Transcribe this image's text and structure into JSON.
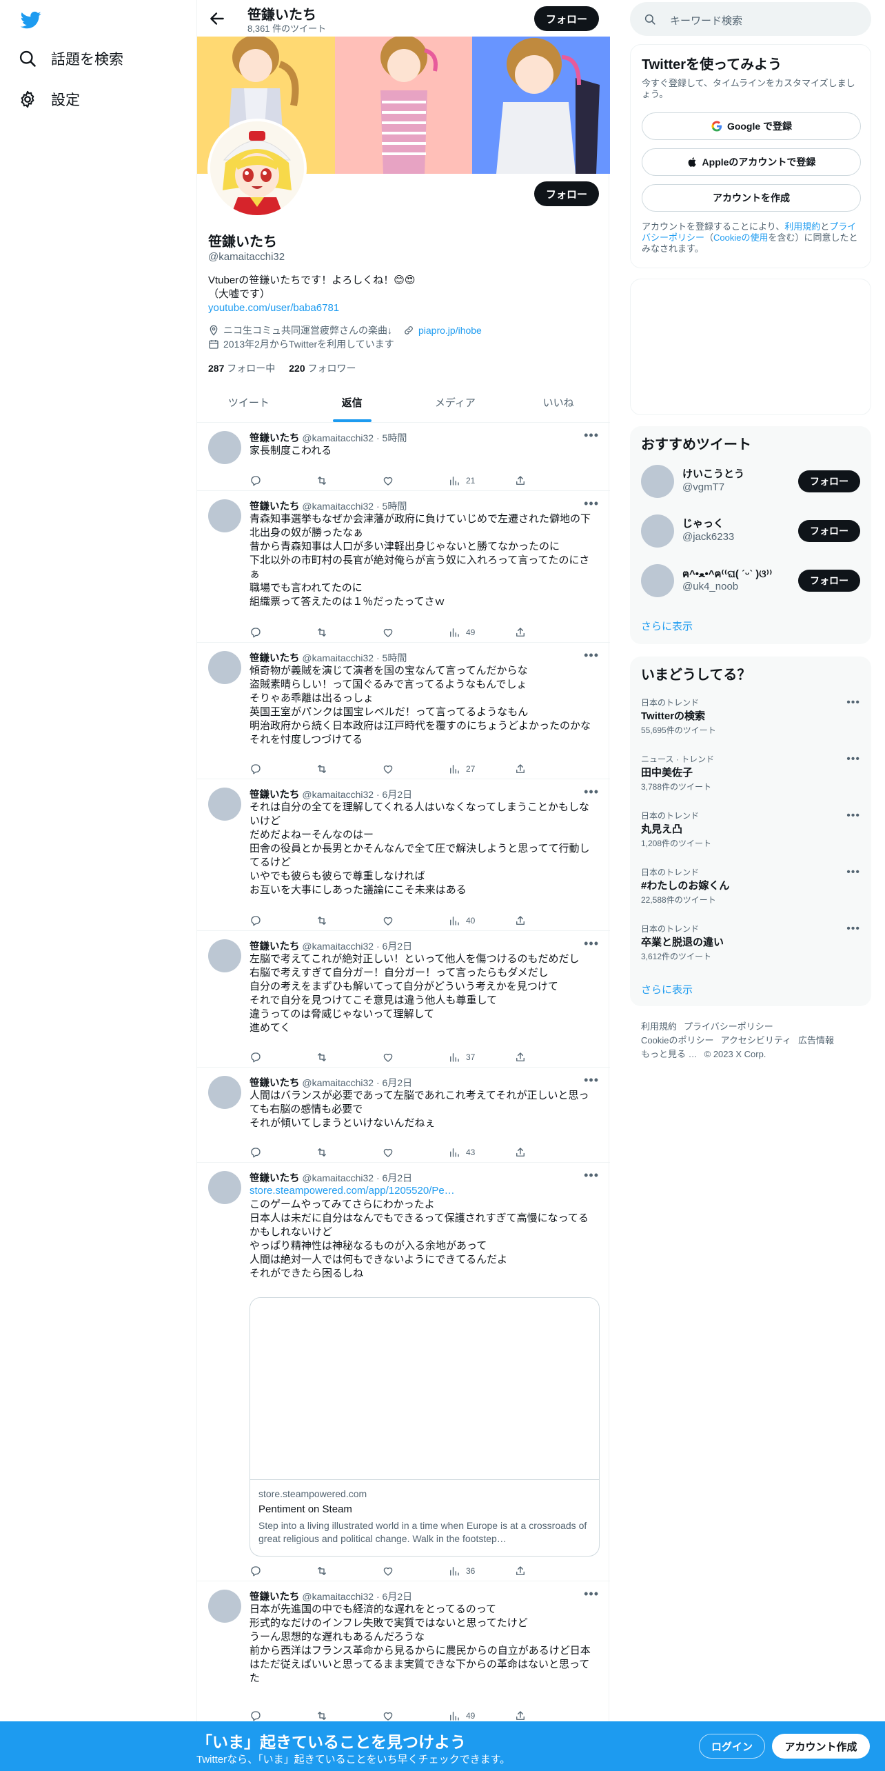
{
  "nav": {
    "items": [
      {
        "label": "話題を検索",
        "icon": "search-icon"
      },
      {
        "label": "設定",
        "icon": "gear-icon"
      }
    ]
  },
  "header": {
    "name": "笹鎌いたち",
    "tweet_count": "8,361 件のツイート",
    "follow_label": "フォロー"
  },
  "profile": {
    "name": "笹鎌いたち",
    "handle": "@kamaitacchi32",
    "follow_label": "フォロー",
    "bio_lines": [
      "Vtuberの笹鎌いたちです！よろしくね！😊😍",
      "（大嘘です）"
    ],
    "bio_link": "youtube.com/user/baba6781",
    "location": "ニコ生コミュ共同運営疲弊さんの楽曲↓",
    "website": "piapro.jp/ihobe",
    "joined": "2013年2月からTwitterを利用しています",
    "following_count": "287",
    "following_label": "フォロー中",
    "followers_count": "220",
    "followers_label": "フォロワー"
  },
  "tabs": [
    {
      "label": "ツイート"
    },
    {
      "label": "返信",
      "active": true
    },
    {
      "label": "メディア"
    },
    {
      "label": "いいね"
    }
  ],
  "tweets": [
    {
      "name": "笹鎌いたち",
      "meta": "@kamaitacchi32 · 5時間",
      "lines": [
        "家長制度こわれる"
      ],
      "views": "21"
    },
    {
      "name": "笹鎌いたち",
      "meta": "@kamaitacchi32 · 5時間",
      "lines": [
        "青森知事選挙もなぜか会津藩が政府に負けていじめで左遷された僻地の下",
        "北出身の奴が勝ったなぁ",
        "昔から青森知事は人口が多い津軽出身じゃないと勝てなかったのに",
        "下北以外の市町村の長官が絶対俺らが言う奴に入れろって言ってたのにさ",
        "ぁ",
        "職場でも言われてたのに",
        "組織票って答えたのは１％だったってさｗ"
      ],
      "views": "49"
    },
    {
      "name": "笹鎌いたち",
      "meta": "@kamaitacchi32 · 5時間",
      "lines": [
        "傾奇物が義賊を演じて演者を国の宝なんて言ってんだからな",
        "盗賊素晴らしい！って国ぐるみで言ってるようなもんでしょ",
        "そりゃあ乖離は出るっしょ",
        "英国王室がパンクは国宝レベルだ！って言ってるようなもん",
        "明治政府から続く日本政府は江戸時代を覆すのにちょうどよかったのかな",
        "それを忖度しつづけてる"
      ],
      "views": "27"
    },
    {
      "name": "笹鎌いたち",
      "meta": "@kamaitacchi32 · 6月2日",
      "lines": [
        "それは自分の全てを理解してくれる人はいなくなってしまうことかもしな",
        "いけど",
        "だめだよねーそんなのはー",
        "田舎の役員とか長男とかそんなんで全て圧で解決しようと思ってて行動し",
        "てるけど",
        "いやでも彼らも彼らで尊重しなければ",
        "お互いを大事にしあった議論にこそ未来はある"
      ],
      "views": "40"
    },
    {
      "name": "笹鎌いたち",
      "meta": "@kamaitacchi32 · 6月2日",
      "lines": [
        "左脳で考えてこれが絶対正しい！といって他人を傷つけるのもだめだし",
        "右脳で考えすぎて自分ガー！自分ガー！って言ったらもダメだし",
        "自分の考えをまずひも解いてって自分がどういう考えかを見つけて",
        "それで自分を見つけてこそ意見は違う他人も尊重して",
        "違うってのは脅威じゃないって理解して",
        "進めてく"
      ],
      "views": "37"
    },
    {
      "name": "笹鎌いたち",
      "meta": "@kamaitacchi32 · 6月2日",
      "lines": [
        "人間はバランスが必要であって左脳であれこれ考えてそれが正しいと思っ",
        "ても右脳の感情も必要で",
        "それが傾いてしまうといけないんだねぇ"
      ],
      "views": "43"
    },
    {
      "name": "笹鎌いたち",
      "meta": "@kamaitacchi32 · 6月2日",
      "link": "store.steampowered.com/app/1205520/Pe…",
      "lines": [
        "このゲームやってみてさらにわかったよ",
        "日本人は未だに自分はなんでもできるって保護されすぎて高慢になってる",
        "かもしれないけど",
        "やっぱり精神性は神秘なるものが入る余地があって",
        "人間は絶対一人では何もできないようにできてるんだよ",
        "それができたら困るしね"
      ],
      "card": {
        "domain": "store.steampowered.com",
        "title": "Pentiment on Steam",
        "desc": "Step into a living illustrated world in a time when Europe is at a crossroads of great religious and political change. Walk in the footstep…"
      },
      "views": "36"
    },
    {
      "name": "笹鎌いたち",
      "meta": "@kamaitacchi32 · 6月2日",
      "lines": [
        "日本が先進国の中でも経済的な遅れをとってるのって",
        "形式的なだけのインフレ失敗で実質ではないと思ってたけど",
        "うーん思想的な遅れもあるんだろうな",
        "前から西洋はフランス革命から見るからに農民からの自立があるけど日本",
        "はただ従えばいいと思ってるまま実質できな下からの革命はないと思って",
        "た"
      ],
      "views": "49"
    }
  ],
  "search": {
    "placeholder": "キーワード検索"
  },
  "join": {
    "title": "Twitterを使ってみよう",
    "subtitle": "今すぐ登録して、タイムラインをカスタマイズしましょう。",
    "google": "Google で登録",
    "apple": "Appleのアカウントで登録",
    "create": "アカウントを作成",
    "legal_a": "アカウントを登録することにより、",
    "legal_terms": "利用規約",
    "legal_and": "と",
    "legal_privacy": "プライバシーポリシー",
    "legal_b": "（",
    "legal_cookie": "Cookieの使用",
    "legal_c": "を含む）に同意したとみなされます。"
  },
  "recommend": {
    "title": "おすすめツイート",
    "users": [
      {
        "name": "けいこうとう",
        "handle": "@vgmT7"
      },
      {
        "name": "じゃっく",
        "handle": "@jack6233"
      },
      {
        "name": "ฅ^•ﻌ•^ฅ⁽⁽ଘ( ˊᵕˋ )ଓ⁾⁾",
        "handle": "@uk4_noob"
      }
    ],
    "follow_label": "フォロー",
    "more": "さらに表示"
  },
  "trends": {
    "title": "いまどうしてる？",
    "items": [
      {
        "category": "日本のトレンド",
        "name": "Twitterの検索",
        "count": "55,695件のツイート"
      },
      {
        "category": "ニュース · トレンド",
        "name": "田中美佐子",
        "count": "3,788件のツイート"
      },
      {
        "category": "日本のトレンド",
        "name": "丸見え凸",
        "count": "1,208件のツイート"
      },
      {
        "category": "日本のトレンド",
        "name": "#わたしのお嫁くん",
        "count": "22,588件のツイート"
      },
      {
        "category": "日本のトレンド",
        "name": "卒業と脱退の違い",
        "count": "3,612件のツイート"
      }
    ],
    "more": "さらに表示"
  },
  "footer": {
    "links": [
      "利用規約",
      "プライバシーポリシー",
      "Cookieのポリシー",
      "アクセシビリティ",
      "広告情報",
      "もっと見る …",
      "© 2023 X Corp."
    ]
  },
  "bottombar": {
    "title": "「いま」起きていることを見つけよう",
    "subtitle": "Twitterなら、「いま」起きていることをいち早くチェックできます。",
    "login": "ログイン",
    "signup": "アカウント作成"
  },
  "colors": {
    "accent": "#1d9bf0",
    "dark": "#0f1419",
    "muted": "#536471",
    "banner": [
      "#ffd972",
      "#ffbfb8",
      "#6895ff"
    ]
  }
}
